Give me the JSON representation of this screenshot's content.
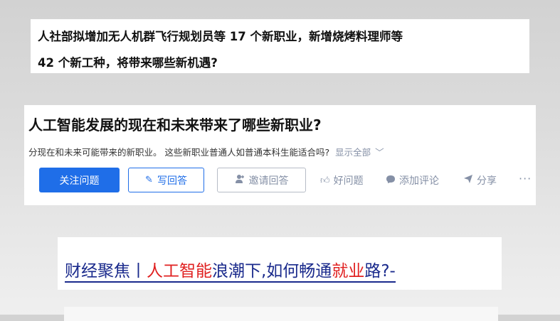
{
  "card1": {
    "line1": "人社部拟增加无人机群飞行规划员等 17 个新职业，新增烧烤料理师等",
    "line2": "42 个新工种，将带来哪些新机遇?"
  },
  "question": {
    "title": "人工智能发展的现在和未来带来了哪些新职业?",
    "excerpt": "分现在和未来可能带来的新职业。 这些新职业普通人如普通本科生能适合吗?",
    "show_all": "显示全部",
    "chevron": "﹀",
    "follow_label": "关注问题",
    "answer_label": "写回答",
    "invite_label": "邀请回答",
    "good_label": "好问题",
    "comment_label": "添加评论",
    "share_label": "分享",
    "more_label": "···"
  },
  "news": {
    "part1": "财经聚焦丨",
    "part2": "人工智能",
    "part3": "浪潮下,如何畅通",
    "part4": "就业",
    "part5": "路?-"
  },
  "colors": {
    "accent": "#1f6ee8",
    "muted": "#8590a6",
    "news_blue": "#1a2a8c",
    "news_red": "#e02020"
  }
}
